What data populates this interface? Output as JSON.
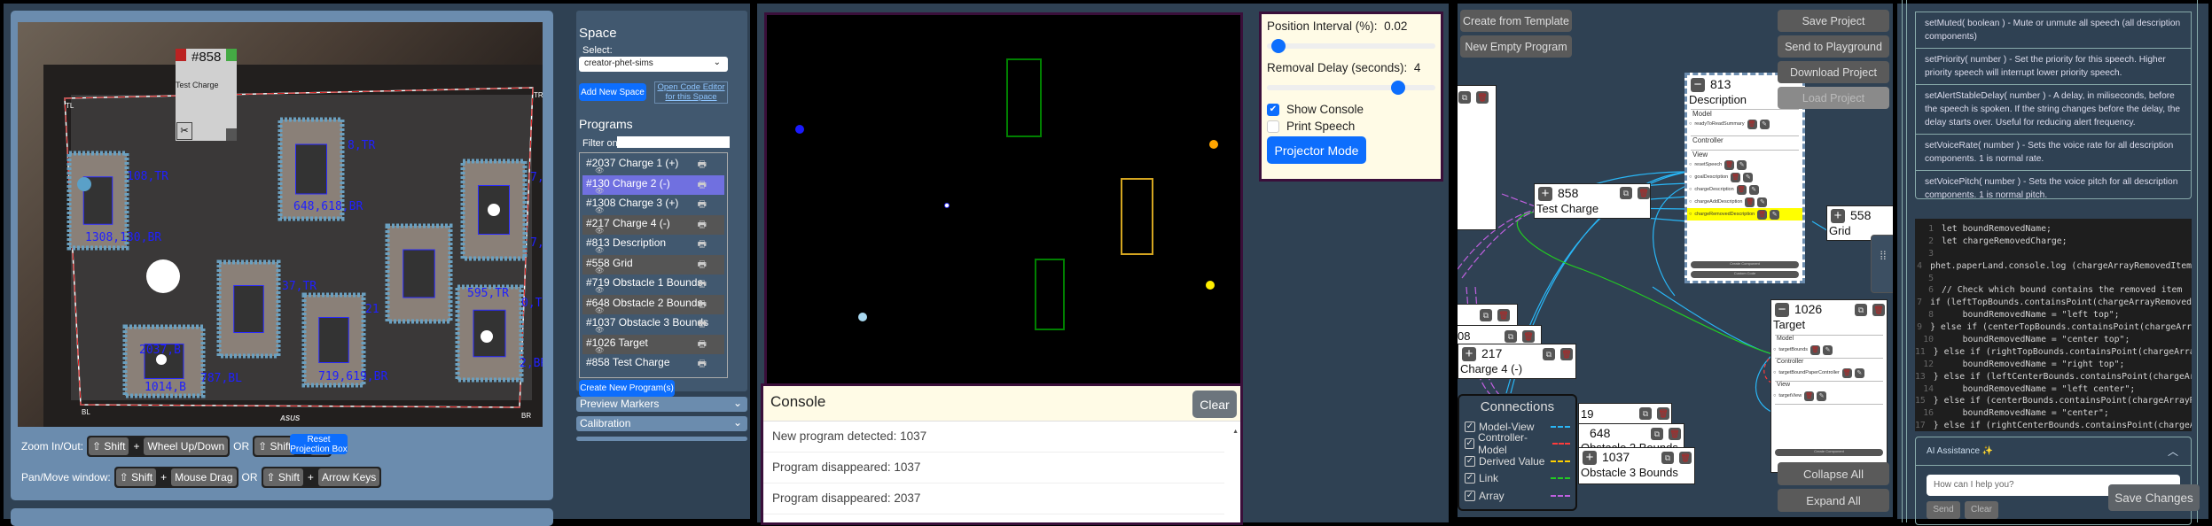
{
  "camera": {
    "overlay_card": {
      "id": "#858",
      "name": "Test Charge",
      "cut_icon": "scissors-icon"
    },
    "corner_labels": [
      "TL",
      "TR",
      "BL",
      "BR"
    ],
    "marker_labels": [
      "108,TR",
      "1308,130,BR",
      "8,TR",
      "648,618,BR",
      "7,TR",
      "7,BR",
      "37,TR",
      "2037,B",
      "1014,B",
      "787,BL",
      "719,619,BR",
      "21",
      "595,TR",
      "0,TR",
      "2,BR"
    ],
    "brand": "ASUS"
  },
  "camera_controls": {
    "zoom_label": "Zoom In/Out:",
    "pan_label": "Pan/Move window:",
    "shift": "⇧ Shift",
    "plus": "+",
    "or": "OR",
    "wheel": "Wheel Up/Down",
    "plusminus": "+/-",
    "mouse_drag": "Mouse Drag",
    "arrow_keys": "Arrow Keys",
    "reset_button": "Reset Projection Box"
  },
  "space": {
    "heading": "Space",
    "select_label": "Select:",
    "selected": "creator-phet-sims",
    "add_button": "Add New Space",
    "editor_link": "Open Code Editor for this Space",
    "programs_heading": "Programs",
    "filter_label": "Filter on:",
    "filter_value": "",
    "programs": [
      {
        "label": "#2037 Charge 1 (+)",
        "state": "normal"
      },
      {
        "label": "#130 Charge 2 (-)",
        "state": "selected"
      },
      {
        "label": "#1308 Charge 3 (+)",
        "state": "normal"
      },
      {
        "label": "#217 Charge 4 (-)",
        "state": "dark"
      },
      {
        "label": "#813 Description",
        "state": "normal"
      },
      {
        "label": "#558 Grid",
        "state": "dark"
      },
      {
        "label": "#719 Obstacle 1 Bounds",
        "state": "normal"
      },
      {
        "label": "#648 Obstacle 2 Bounds",
        "state": "dark"
      },
      {
        "label": "#1037 Obstacle 3 Bounds",
        "state": "normal"
      },
      {
        "label": "#1026 Target",
        "state": "dark"
      },
      {
        "label": "#858 Test Charge",
        "state": "normal"
      }
    ],
    "create_button": "Create New Program(s)",
    "accordions": [
      "Preview Markers",
      "Calibration"
    ]
  },
  "projector": {
    "position_interval_label": "Position Interval (%):",
    "position_interval_value": "0.02",
    "position_interval_fraction": 0.03,
    "removal_delay_label": "Removal Delay (seconds):",
    "removal_delay_value": "4",
    "removal_delay_fraction": 0.78,
    "show_console_label": "Show Console",
    "show_console": true,
    "print_speech_label": "Print Speech",
    "print_speech": false,
    "projector_button": "Projector Mode",
    "colors": {
      "green": "#008000",
      "yellow": "#d4a520",
      "blue_dot": "#1a1aff",
      "orange_dot": "#ffa500",
      "yellow_dot": "#ffee00",
      "light_dot": "#a8d8f0"
    }
  },
  "console": {
    "title": "Console",
    "clear_button": "Clear",
    "entries": [
      "New program detected: 1037",
      "Program disappeared: 1037",
      "Program disappeared: 2037"
    ]
  },
  "editor": {
    "create_template": "Create from Template",
    "new_empty": "New Empty Program",
    "save_project": "Save Project",
    "send_playground": "Send to Playground",
    "download_project": "Download Project",
    "load_project": "Load Project",
    "collapse_all": "Collapse All",
    "expand_all": "Expand All",
    "nodes": {
      "description": {
        "id": "813",
        "name": "Description",
        "model": "Model",
        "controller": "Controller",
        "view": "View",
        "model_items": [
          "readyToReadSummary"
        ],
        "view_items": [
          "resetSpeech",
          "goalDescription",
          "chargeDescription",
          "chargeAddDescription",
          "chargeRemovedDescription"
        ],
        "create_component": "Create Component",
        "custom_code": "Custom Code"
      },
      "test_charge": {
        "id": "858",
        "name": "Test Charge"
      },
      "grid": {
        "id": "558",
        "name": "Grid"
      },
      "charge4": {
        "id": "217",
        "name": "Charge 4 (-)"
      },
      "partial_08": {
        "id": "08"
      },
      "obstacle1": {
        "id": "19"
      },
      "obstacle2": {
        "id": "648",
        "name": "Obstacle 2 Bounds"
      },
      "obstacle3": {
        "id": "1037",
        "name": "Obstacle 3 Bounds"
      },
      "target": {
        "id": "1026",
        "name": "Target",
        "model": "Model",
        "controller": "Controller",
        "view": "View",
        "model_items": [
          "targetBounds"
        ],
        "controller_items": [
          "targetBoundPaperController"
        ],
        "view_items": [
          "targetView"
        ],
        "create_component": "Create Component"
      }
    },
    "legend": {
      "title": "Connections",
      "items": [
        {
          "label": "Model-View",
          "color": "#29b6f6",
          "checked": true
        },
        {
          "label": "Controller-Model",
          "color": "#ff3b3b",
          "checked": true
        },
        {
          "label": "Derived Value",
          "color": "#ffd000",
          "checked": true
        },
        {
          "label": "Link",
          "color": "#22cc22",
          "checked": true
        },
        {
          "label": "Array",
          "color": "#c060e0",
          "checked": true
        }
      ]
    }
  },
  "docs": [
    "setMuted( boolean ) - Mute or unmute all speech (all description components)",
    "setPriority( number ) - Set the priority for this speech. Higher priority speech will interrupt lower priority speech.",
    "setAlertStableDelay( number ) - A delay, in miliseconds, before the speech is spoken. If the string changes before the delay, the delay starts over. Useful for reducing alert frequency.",
    "setVoiceRate( number ) - Sets the voice rate for all description components. 1 is normal rate.",
    "setVoicePitch( number ) - Sets the voice pitch for all description components. 1 is normal pitch."
  ],
  "code": [
    "let boundRemovedName;",
    "let chargeRemovedCharge;",
    "",
    "phet.paperLand.console.log (chargeArrayRemovedItem",
    "",
    "// Check which bound contains the removed item",
    "if (leftTopBounds.containsPoint(chargeArrayRemoved",
    "    boundRemovedName = \"left top\";",
    "} else if (centerTopBounds.containsPoint(chargeArr",
    "    boundRemovedName = \"center top\";",
    "} else if (rightTopBounds.containsPoint(chargeArra",
    "    boundRemovedName = \"right top\";",
    "} else if (leftCenterBounds.containsPoint(chargeAr",
    "    boundRemovedName = \"left center\";",
    "} else if (centerBounds.containsPoint(chargeArrayR",
    "    boundRemovedName = \"center\";",
    "} else if (rightCenterBounds.containsPoint(chargeA"
  ],
  "ai": {
    "title": "AI Assistance ✨",
    "placeholder": "How can I help you?",
    "send": "Send",
    "clear": "Clear"
  },
  "save_changes": "Save Changes"
}
